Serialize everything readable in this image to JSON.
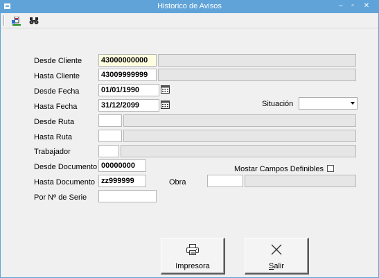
{
  "window": {
    "title": "Historico de Avisos",
    "controls": {
      "minimize": "–",
      "maximize": "▫",
      "close": "✕"
    }
  },
  "toolbar": {
    "buttons": [
      {
        "name": "print-preview-icon"
      },
      {
        "name": "binoculars-icon"
      }
    ]
  },
  "form": {
    "desde_cliente": {
      "label": "Desde Cliente",
      "value": "43000000000",
      "description": ""
    },
    "hasta_cliente": {
      "label": "Hasta Cliente",
      "value": "43009999999",
      "description": ""
    },
    "desde_fecha": {
      "label": "Desde Fecha",
      "value": "01/01/1990"
    },
    "hasta_fecha": {
      "label": "Hasta Fecha",
      "value": "31/12/2099"
    },
    "situacion": {
      "label": "Situación",
      "value": ""
    },
    "desde_ruta": {
      "label": "Desde Ruta",
      "value": "",
      "description": ""
    },
    "hasta_ruta": {
      "label": "Hasta Ruta",
      "value": "",
      "description": ""
    },
    "trabajador": {
      "label": "Trabajador",
      "value": "",
      "description": ""
    },
    "desde_documento": {
      "label": "Desde Documento",
      "value": "00000000"
    },
    "hasta_documento": {
      "label": "Hasta Documento",
      "value": "zz999999"
    },
    "mostrar_campos": {
      "label": "Mostar Campos Definibles",
      "checked": false
    },
    "obra": {
      "label": "Obra",
      "value": "",
      "description": ""
    },
    "numero_serie": {
      "label": "Por Nº de Serie",
      "value": ""
    }
  },
  "buttons": {
    "impresora": {
      "label": "Impresora"
    },
    "salir": {
      "label_first": "S",
      "label_rest": "alir"
    }
  }
}
